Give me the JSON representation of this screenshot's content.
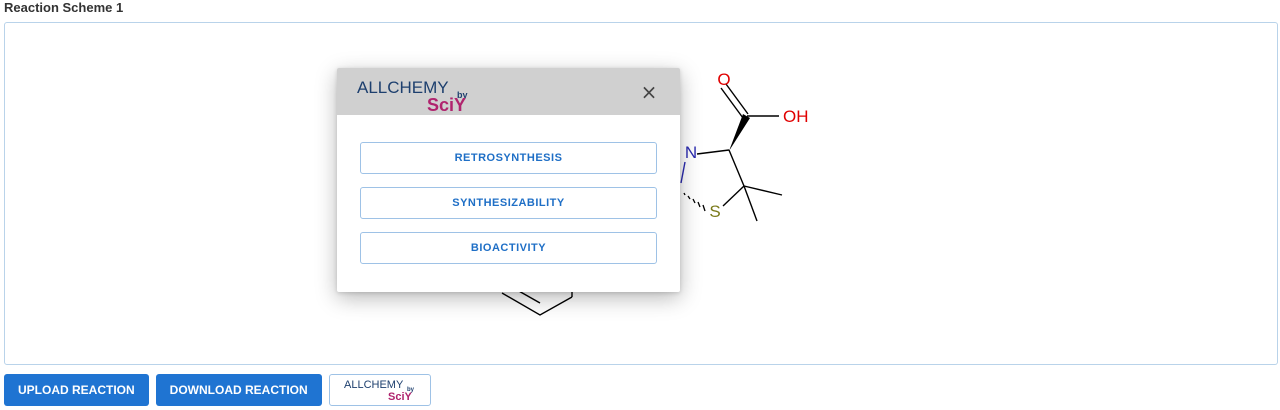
{
  "section": {
    "title": "Reaction Scheme 1"
  },
  "molecule": {
    "atom_labels": {
      "oxygen": "O",
      "hydroxyl": "OH",
      "nitrogen": "N",
      "sulfur": "S"
    },
    "colors": {
      "oxygen": "#e00000",
      "nitrogen": "#2b2bb0",
      "sulfur": "#7a7a1a",
      "bond": "#000000"
    }
  },
  "modal": {
    "logo": {
      "main": "ALLCHEMY",
      "by": "by",
      "brand": "SciY"
    },
    "close_symbol": "×",
    "options": [
      {
        "label": "RETROSYNTHESIS"
      },
      {
        "label": "SYNTHESIZABILITY"
      },
      {
        "label": "BIOACTIVITY"
      }
    ]
  },
  "toolbar": {
    "upload_label": "UPLOAD REACTION",
    "download_label": "DOWNLOAD REACTION",
    "logo": {
      "main": "ALLCHEMY",
      "by": "by",
      "brand": "SciY"
    }
  },
  "colors": {
    "primary": "#1f74d2",
    "outline": "#9ec2e6",
    "logo_text": "#1d3f6e",
    "logo_brand": "#b0246e",
    "header_bg": "#d0d0d0"
  }
}
